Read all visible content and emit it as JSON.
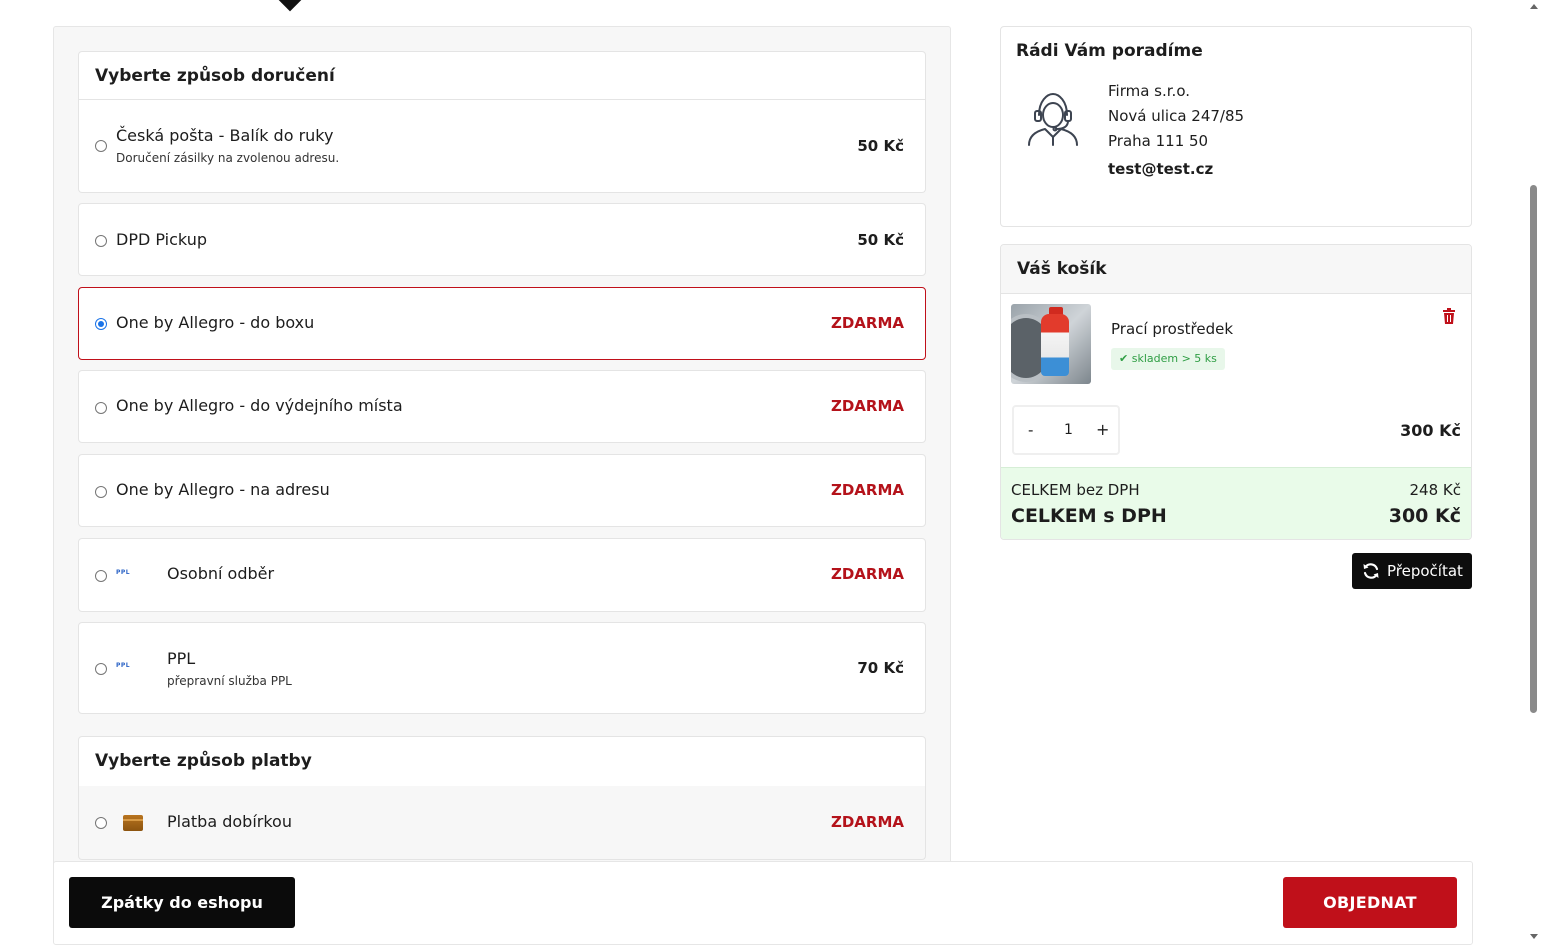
{
  "delivery": {
    "title": "Vyberte způsob doručení",
    "options": [
      {
        "name": "Česká pošta - Balík do ruky",
        "desc": "Doručení zásilky na zvolenou adresu.",
        "price": "50 Kč",
        "free": false,
        "selected": false
      },
      {
        "name": "DPD Pickup",
        "price": "50 Kč",
        "free": false,
        "selected": false
      },
      {
        "name": "One by Allegro - do boxu",
        "price": "ZDARMA",
        "free": true,
        "selected": true
      },
      {
        "name": "One by Allegro - do výdejního místa",
        "price": "ZDARMA",
        "free": true,
        "selected": false
      },
      {
        "name": "One by Allegro - na adresu",
        "price": "ZDARMA",
        "free": true,
        "selected": false
      },
      {
        "name": "Osobní odběr",
        "price": "ZDARMA",
        "free": true,
        "selected": false,
        "logo": "PPL"
      },
      {
        "name": "PPL",
        "desc": "přepravní služba PPL",
        "price": "70 Kč",
        "free": false,
        "selected": false,
        "logo": "PPL"
      }
    ]
  },
  "payment": {
    "title": "Vyberte způsob platby",
    "options": [
      {
        "name": "Platba dobírkou",
        "price": "ZDARMA",
        "free": true,
        "selected": false,
        "icon": "wallet-icon"
      }
    ]
  },
  "help": {
    "title": "Rádi Vám poradíme",
    "company": "Firma s.r.o.",
    "street": "Nová ulica 247/85",
    "city": "Praha 111 50",
    "email": "test@test.cz",
    "icon": "customer-support-icon"
  },
  "cart": {
    "title": "Váš košík",
    "item": {
      "name": "Prací prostředek",
      "stock": "skladem > 5 ks",
      "qty_minus": "-",
      "qty": "1",
      "qty_plus": "+",
      "price": "300 Kč"
    },
    "total_no_vat_label": "CELKEM bez DPH",
    "total_no_vat": "248 Kč",
    "total_vat_label": "CELKEM s DPH",
    "total_vat": "300 Kč",
    "recalc_label": "Přepočítat"
  },
  "footer": {
    "back_label": "Zpátky do eshopu",
    "order_label": "OBJEDNAT"
  },
  "colors": {
    "accent": "#c0101a",
    "free_price": "#b4121a",
    "stock_green": "#2f9e44",
    "totals_bg": "#e9fbe9"
  }
}
